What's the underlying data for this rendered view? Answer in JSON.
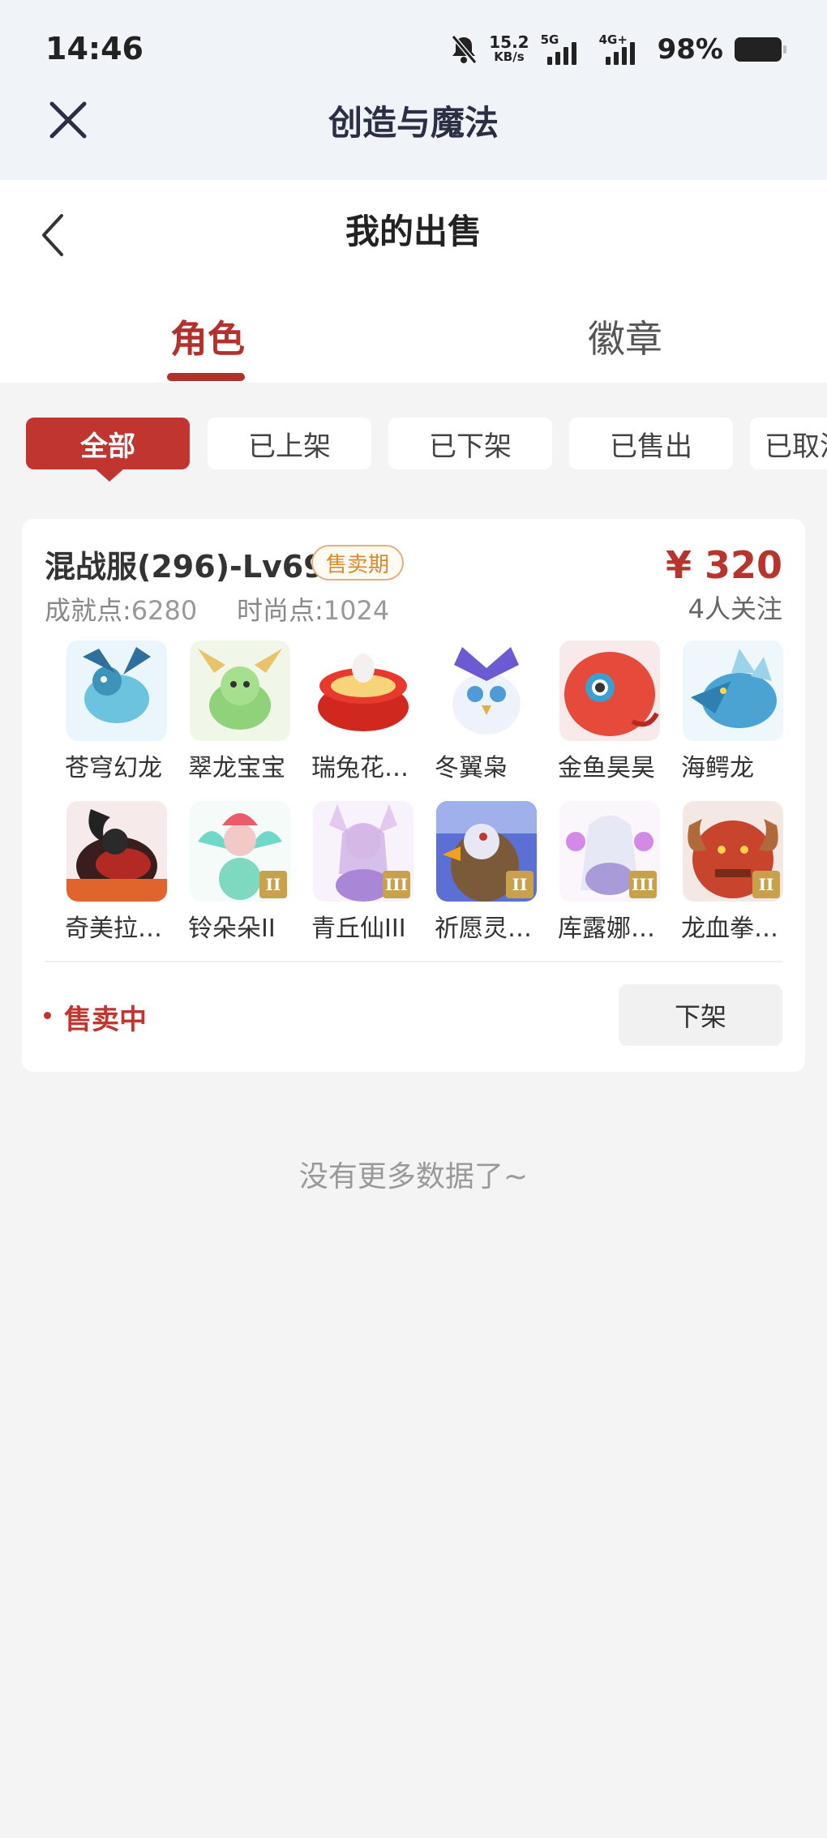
{
  "status_bar": {
    "time": "14:46",
    "net_speed": "15.2",
    "net_unit": "KB/s",
    "sim1": "5G",
    "sim2": "4G+",
    "battery": "98%"
  },
  "app_bar": {
    "title": "创造与魔法"
  },
  "page": {
    "title": "我的出售"
  },
  "tabs": [
    {
      "label": "角色",
      "active": true
    },
    {
      "label": "徽章",
      "active": false
    }
  ],
  "filters": [
    {
      "label": "全部",
      "active": true
    },
    {
      "label": "已上架"
    },
    {
      "label": "已下架"
    },
    {
      "label": "已售出"
    },
    {
      "label": "已取消"
    }
  ],
  "listing": {
    "server": "混战服(296)-Lv69",
    "badge": "售卖期",
    "price": "¥ 320",
    "followers": "4人关注",
    "achievement_label": "成就点:",
    "achievement_value": "6280",
    "fashion_label": "时尚点:",
    "fashion_value": "1024",
    "pets": [
      {
        "name": "苍穹幻龙",
        "rank": ""
      },
      {
        "name": "翠龙宝宝",
        "rank": ""
      },
      {
        "name": "瑞兔花…",
        "rank": ""
      },
      {
        "name": "冬翼枭",
        "rank": ""
      },
      {
        "name": "金鱼昊昊",
        "rank": ""
      },
      {
        "name": "海鳄龙",
        "rank": ""
      },
      {
        "name": "奇美拉…",
        "rank": ""
      },
      {
        "name": "铃朵朵II",
        "rank": "II"
      },
      {
        "name": "青丘仙III",
        "rank": "III"
      },
      {
        "name": "祈愿灵…",
        "rank": "II"
      },
      {
        "name": "库露娜…",
        "rank": "III"
      },
      {
        "name": "龙血拳…",
        "rank": "II"
      }
    ],
    "status": "售卖中",
    "action": "下架"
  },
  "footer": {
    "no_more": "没有更多数据了~"
  },
  "colors": {
    "accent": "#c0352f",
    "badge": "#d98a2e"
  }
}
